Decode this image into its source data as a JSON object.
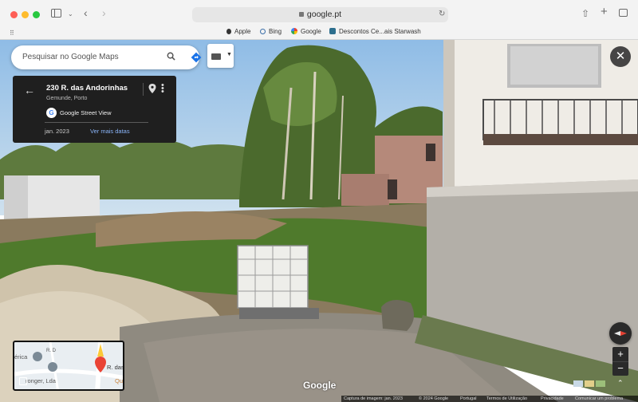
{
  "browser": {
    "url": "google.pt",
    "bookmarks": [
      {
        "label": "Apple",
        "icon": "apple-icon"
      },
      {
        "label": "Bing",
        "icon": "bing-search-icon"
      },
      {
        "label": "Google",
        "icon": "google-icon"
      },
      {
        "label": "Descontos Ce...ais Starwash",
        "icon": "starwash-icon"
      }
    ]
  },
  "search": {
    "placeholder": "Pesquisar no Google Maps"
  },
  "info_card": {
    "title": "230 R. das Andorinhas",
    "locality": "Gemunde, Porto",
    "source": "Google Street View",
    "date": "jan. 2023",
    "more_dates": "Ver mais datas"
  },
  "mini_map": {
    "labels": [
      "érica",
      "R. D",
      "R. das",
      "ronger, Lda",
      "Qu"
    ]
  },
  "watermark": "Google",
  "footer": {
    "capture": "Captura de imagem: jan. 2023",
    "copyright": "© 2024 Google",
    "country": "Portugal",
    "terms": "Termos de Utilização",
    "privacy": "Privacidade",
    "report": "Comunicar um problema"
  },
  "colors": {
    "accent_link": "#8ab4f8",
    "card_bg": "#1f1f1f",
    "pin_red": "#ea4335"
  }
}
